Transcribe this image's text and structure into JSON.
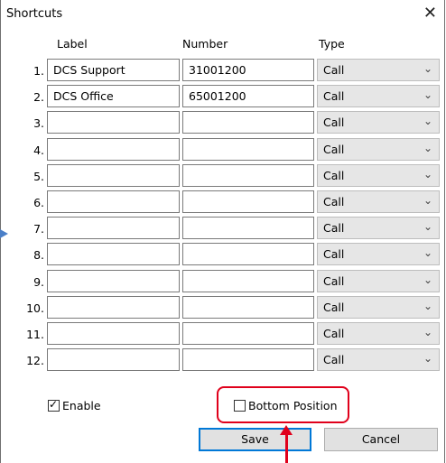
{
  "window": {
    "title": "Shortcuts",
    "close_glyph": "✕"
  },
  "headers": {
    "label": "Label",
    "number": "Number",
    "type": "Type"
  },
  "rows": [
    {
      "index": "1.",
      "label": "DCS Support",
      "number": "31001200",
      "type": "Call"
    },
    {
      "index": "2.",
      "label": "DCS Office",
      "number": "65001200",
      "type": "Call"
    },
    {
      "index": "3.",
      "label": "",
      "number": "",
      "type": "Call"
    },
    {
      "index": "4.",
      "label": "",
      "number": "",
      "type": "Call"
    },
    {
      "index": "5.",
      "label": "",
      "number": "",
      "type": "Call"
    },
    {
      "index": "6.",
      "label": "",
      "number": "",
      "type": "Call"
    },
    {
      "index": "7.",
      "label": "",
      "number": "",
      "type": "Call"
    },
    {
      "index": "8.",
      "label": "",
      "number": "",
      "type": "Call"
    },
    {
      "index": "9.",
      "label": "",
      "number": "",
      "type": "Call"
    },
    {
      "index": "10.",
      "label": "",
      "number": "",
      "type": "Call"
    },
    {
      "index": "11.",
      "label": "",
      "number": "",
      "type": "Call"
    },
    {
      "index": "12.",
      "label": "",
      "number": "",
      "type": "Call"
    }
  ],
  "options": {
    "enable": {
      "label": "Enable",
      "checked": true
    },
    "bottom_position": {
      "label": "Bottom Position",
      "checked": false
    }
  },
  "buttons": {
    "save": "Save",
    "cancel": "Cancel"
  },
  "colors": {
    "default_button_border": "#0078d7",
    "annotation_red": "#e0001b",
    "annotation_blue": "#4a7fc8"
  }
}
